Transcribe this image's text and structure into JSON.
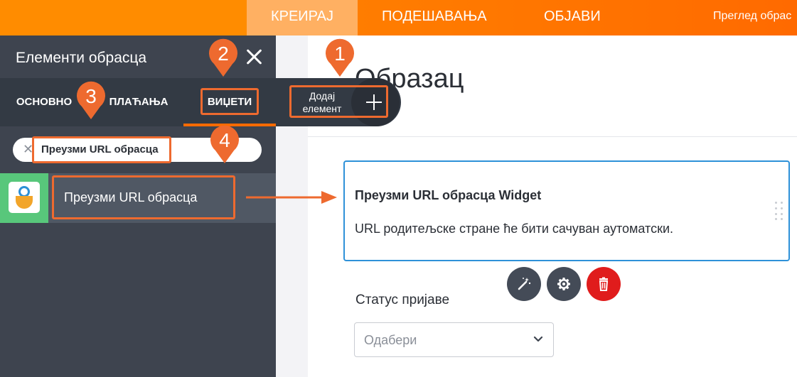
{
  "topnav": {
    "tabs": [
      {
        "label": "КРЕИРАЈ",
        "active": true
      },
      {
        "label": "ПОДЕШАВАЊА",
        "active": false
      },
      {
        "label": "ОБЈАВИ",
        "active": false
      }
    ],
    "preview_link": "Преглед обрас"
  },
  "panel": {
    "title": "Елементи обрасца",
    "tabs": [
      {
        "label": "ОСНОВНО"
      },
      {
        "label": "ПЛАЋАЊА"
      },
      {
        "label": "ВИЏЕТИ",
        "active": true
      }
    ],
    "search": {
      "value": "Преузми URL обрасца"
    },
    "results": [
      {
        "label": "Преузми URL обрасца",
        "icon": "get-form-url-widget-icon"
      }
    ]
  },
  "add_element": {
    "label": "Додај елемент"
  },
  "form": {
    "title": "Образац",
    "widget": {
      "title": "Преузми URL обрасца Widget",
      "description": "URL родитељске стране ће бити сачуван аутоматски."
    },
    "actions": [
      {
        "name": "wand-icon",
        "color": "#444b57"
      },
      {
        "name": "gear-icon",
        "color": "#444b57"
      },
      {
        "name": "trash-icon",
        "color": "#e01c1c"
      }
    ],
    "status_field": {
      "label": "Статус пријаве",
      "select_value": "Одабери"
    }
  },
  "annotations": {
    "markers": [
      "1",
      "2",
      "3",
      "4"
    ],
    "accent_color": "#ee6a2f"
  },
  "colors": {
    "brand_orange": "#ff7a00",
    "panel_bg": "#3e444f",
    "selection_blue": "#2e91d8"
  }
}
